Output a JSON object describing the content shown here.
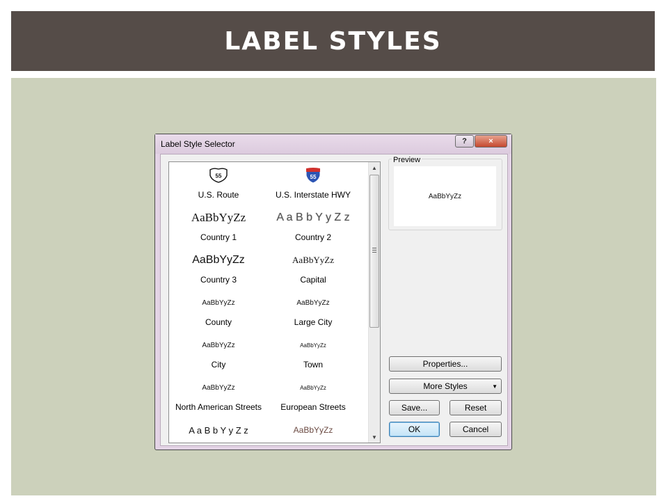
{
  "slide": {
    "title": "LABEL STYLES",
    "colors": {
      "title_bar": "#554c48",
      "content_bg": "#ccd1bb"
    }
  },
  "dialog": {
    "title": "Label Style Selector",
    "help_label": "?",
    "close_label": "×",
    "gallery": {
      "items": [
        {
          "sample": "55",
          "sample_kind": "us-route-shield-icon",
          "label": "U.S. Route"
        },
        {
          "sample": "55",
          "sample_kind": "interstate-shield-icon",
          "label": "U.S. Interstate HWY"
        },
        {
          "sample": "AaBbYyZz",
          "label": "Country 1"
        },
        {
          "sample": "A a B b Y y Z z",
          "label": "Country 2"
        },
        {
          "sample": "AaBbYyZz",
          "label": "Country 3"
        },
        {
          "sample": "AaBbYyZz",
          "label": "Capital"
        },
        {
          "sample": "AaBbYyZz",
          "label": "County"
        },
        {
          "sample": "AaBbYyZz",
          "label": "Large City"
        },
        {
          "sample": "AaBbYyZz",
          "label": "City"
        },
        {
          "sample": "AaBbYyZz",
          "label": "Town"
        },
        {
          "sample": "AaBbYyZz",
          "label": "North American Streets"
        },
        {
          "sample": "AaBbYyZz",
          "label": "European Streets"
        },
        {
          "sample": "A a B b Y y Z z",
          "label": ""
        },
        {
          "sample": "AaBbYyZz",
          "label": ""
        }
      ]
    },
    "preview": {
      "label": "Preview",
      "sample": "AaBbYyZz"
    },
    "buttons": {
      "properties": "Properties...",
      "more_styles": "More Styles",
      "save": "Save...",
      "reset": "Reset",
      "ok": "OK",
      "cancel": "Cancel"
    }
  }
}
